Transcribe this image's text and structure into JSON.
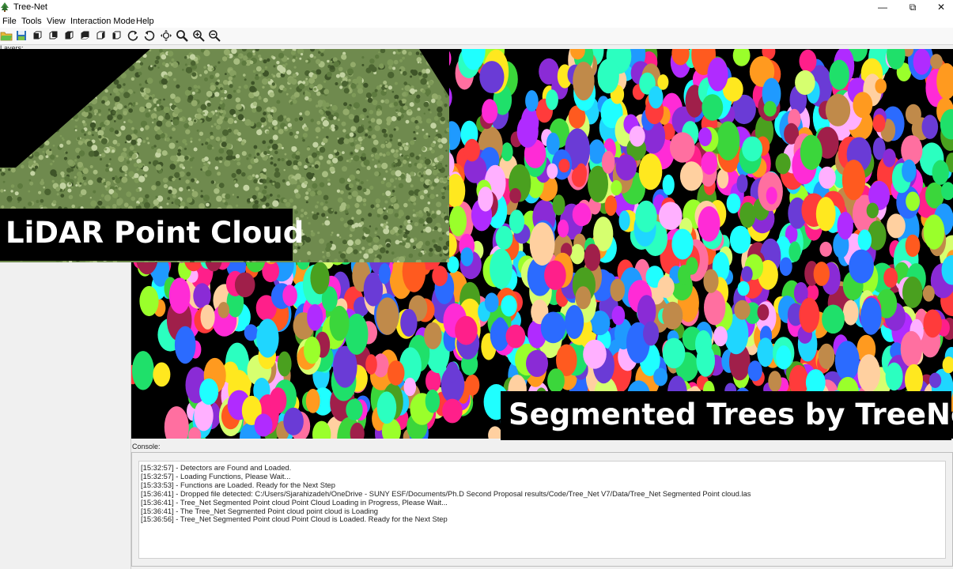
{
  "window": {
    "title": "Tree-Net",
    "minimize_glyph": "—",
    "maximize_glyph": "⧉",
    "close_glyph": "✕"
  },
  "menu": [
    {
      "label": "File"
    },
    {
      "label": "Tools"
    },
    {
      "label": "View"
    },
    {
      "label": "Interaction Mode"
    },
    {
      "label": "Help"
    }
  ],
  "toolbar": {
    "buttons": [
      {
        "icon": "open-folder-icon"
      },
      {
        "icon": "save-icon"
      },
      {
        "icon": "view-front-icon"
      },
      {
        "icon": "view-back-icon"
      },
      {
        "icon": "view-top-icon"
      },
      {
        "icon": "view-bottom-icon"
      },
      {
        "icon": "view-left-icon"
      },
      {
        "icon": "view-right-icon"
      },
      {
        "icon": "rotate-cw-icon"
      },
      {
        "icon": "rotate-ccw-icon"
      },
      {
        "icon": "pan-icon"
      },
      {
        "icon": "zoom-fit-icon"
      },
      {
        "icon": "zoom-in-icon"
      },
      {
        "icon": "zoom-out-icon"
      }
    ]
  },
  "layers_label": "Layers:",
  "captions": {
    "lidar": "LiDAR Point Cloud",
    "segmented": "Segmented Trees by TreeNet"
  },
  "console": {
    "label": "Console:",
    "lines": [
      "[15:32:57] - Detectors are Found and Loaded.",
      "[15:32:57] - Loading Functions, Please Wait...",
      "[15:33:53] - Functions are Loaded. Ready for the Next Step",
      "[15:36:41] - Dropped file detected: C:/Users/Sjarahizadeh/OneDrive - SUNY ESF/Documents/Ph.D Second Proposal results/Code/Tree_Net V7/Data/Tree_Net Segmented Point cloud.las",
      "[15:36:41] - Tree_Net Segmented Point cloud Point Cloud Loading in Progress, Please Wait...",
      "[15:36:41] - The Tree_Net Segmented Point cloud point cloud is Loading",
      "[15:36:56] - Tree_Net Segmented Point cloud Point Cloud is Loaded. Ready for the Next Step"
    ]
  },
  "colors": {
    "canopy_green": "#6f8a4e",
    "viewport_background": "#000000",
    "segment_palette": [
      "#ff2bd6",
      "#1fe06a",
      "#ff9a1f",
      "#2b6bff",
      "#ffe81f",
      "#b02bff",
      "#1fd6ff",
      "#ff3b3b",
      "#9aff2b",
      "#ff6fa0",
      "#2bffc0",
      "#ffb0ff",
      "#c08a4a",
      "#6a3bd6",
      "#ff5a1f",
      "#1f9aff",
      "#d6ff6f",
      "#a01f4a",
      "#4aa01f",
      "#ffd0a0",
      "#8a2bd6",
      "#1fffff",
      "#ff1f8a",
      "#3bd63b"
    ]
  },
  "images": [
    "lidar-point-cloud-canopy",
    "segmented-trees-point-cloud"
  ]
}
